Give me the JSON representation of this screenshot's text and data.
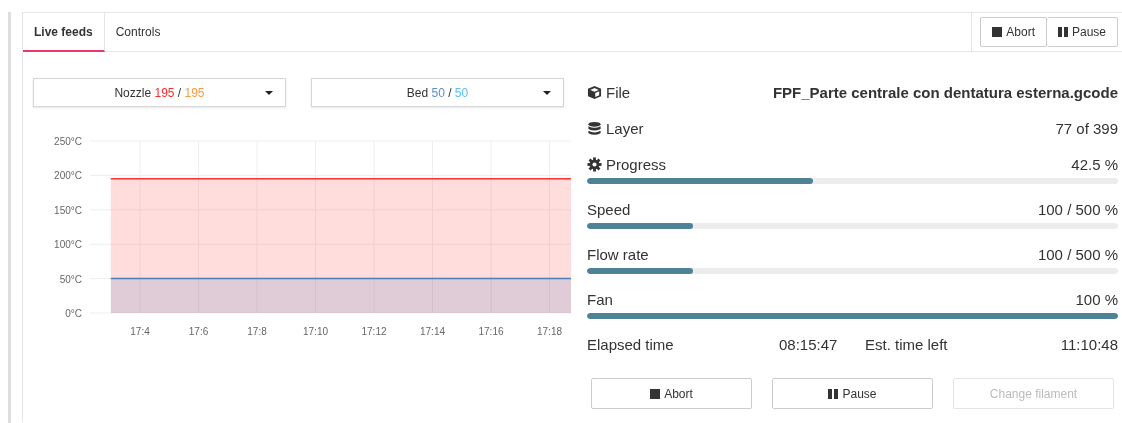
{
  "tabs": [
    {
      "label": "Live feeds",
      "selected": true
    },
    {
      "label": "Controls",
      "selected": false
    }
  ],
  "toolbar_buttons": [
    {
      "label": "Abort",
      "kind": "abort"
    },
    {
      "label": "Pause",
      "kind": "pause"
    }
  ],
  "heaters": [
    {
      "kind": "nozzle",
      "name": "Nozzle",
      "actual": "195",
      "separator": "/",
      "target": "195"
    },
    {
      "kind": "bed",
      "name": "Bed",
      "actual": "50",
      "separator": "/",
      "target": "50"
    }
  ],
  "temperature_chart": {
    "chart_data": {
      "type": "area",
      "grid": true,
      "categories": [
        null,
        "17:4",
        null,
        "17:6",
        null,
        "17:8",
        null,
        "17:10",
        null,
        "17:12",
        null,
        "17:14",
        null,
        "17:16",
        null,
        "17:18",
        null
      ],
      "ylim": [
        0,
        250
      ],
      "yticks": [
        {
          "value": 0,
          "label": "0°C"
        },
        {
          "value": 50,
          "label": "50°C"
        },
        {
          "value": 100,
          "label": "100°C"
        },
        {
          "value": 150,
          "label": "150°C"
        },
        {
          "value": 200,
          "label": "200°C"
        },
        {
          "value": 250,
          "label": "250°C"
        }
      ],
      "series": [
        {
          "color": "#ff3333",
          "values": [
            195,
            195,
            195,
            195,
            195,
            195,
            195,
            195,
            195,
            195,
            195,
            195,
            195,
            195,
            195,
            195,
            195
          ]
        },
        {
          "color": "#4a7fb5",
          "values": [
            50,
            50,
            50,
            50,
            50,
            50,
            50,
            50,
            50,
            50,
            50,
            50,
            50,
            50,
            50,
            50,
            50
          ]
        }
      ]
    }
  },
  "stats": [
    {
      "kind": "file",
      "label": "File",
      "value": "FPF_Parte centrale con dentatura esterna.gcode"
    },
    {
      "kind": "layer",
      "label": "Layer",
      "value": "77 of 399"
    },
    {
      "kind": "progress",
      "label": "Progress",
      "value": "42.5 %",
      "level": 0.425
    },
    {
      "kind": "bar",
      "label": "Speed",
      "value": "100 / 500 %",
      "level": 0.2
    },
    {
      "kind": "bar",
      "label": "Flow rate",
      "value": "100 / 500 %",
      "level": 0.2
    },
    {
      "kind": "bar",
      "label": "Fan",
      "value": "100 %",
      "level": 1
    }
  ],
  "times": {
    "elapsed_label": "Elapsed time",
    "elapsed": "08:15:47",
    "left_label": "Est. time left",
    "left": "11:10:48"
  },
  "actions": [
    {
      "label": "Abort",
      "kind": "abort",
      "disabled": false
    },
    {
      "label": "Pause",
      "kind": "pause",
      "disabled": false
    },
    {
      "label": "Change filament",
      "kind": "text",
      "disabled": true
    }
  ]
}
